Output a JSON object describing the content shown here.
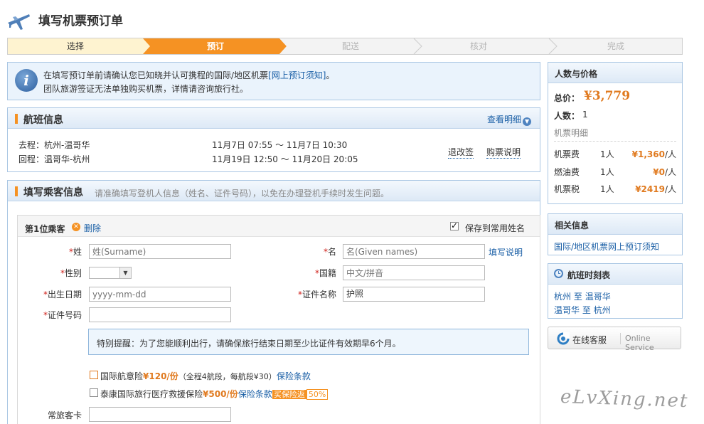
{
  "page": {
    "title": "填写机票预订单"
  },
  "steps": [
    {
      "label": "选择",
      "state": "done"
    },
    {
      "label": "预订",
      "state": "current"
    },
    {
      "label": "配送",
      "state": "todo"
    },
    {
      "label": "核对",
      "state": "todo"
    },
    {
      "label": "完成",
      "state": "todo"
    }
  ],
  "notice": {
    "line1": "在填写预订单前请确认您已知晓并认可携程的国际/地区机票",
    "link": "[网上预订须知]",
    "line1_end": "。",
    "line2": "团队旅游签证无法单独购买机票，详情请咨询旅行社。"
  },
  "flight": {
    "title": "航班信息",
    "detail_link": "查看明细",
    "outbound": {
      "label": "去程：",
      "route": "杭州-温哥华",
      "time": "11月7日 07:55 ～ 11月7日 10:30"
    },
    "return": {
      "label": "回程：",
      "route": "温哥华-杭州",
      "time": "11月19日 12:50 ～ 11月20日 20:05"
    },
    "refund_link": "退改签",
    "purchase_link": "购票说明"
  },
  "passenger": {
    "title": "填写乘客信息",
    "subtitle": "请准确填写登机人信息（姓名、证件号码），以免在办理登机手续时发生问题。",
    "first_label": "第1位乘客",
    "delete_label": "删除",
    "save_label": "保存到常用姓名",
    "surname_label": "姓",
    "surname_placeholder": "姓(Surname)",
    "given_label": "名",
    "given_placeholder": "名(Given names)",
    "help_link": "填写说明",
    "gender_label": "性别",
    "nationality_label": "国籍",
    "nationality_placeholder": "中文/拼音",
    "dob_label": "出生日期",
    "dob_placeholder": "yyyy-mm-dd",
    "id_type_label": "证件名称",
    "id_type_value": "护照",
    "id_no_label": "证件号码",
    "tip": "特别提醒：为了您能顺利出行，请确保旅行结束日期至少比证件有效期早6个月。",
    "ins1": {
      "name": "国际航意险",
      "price": "¥120/份",
      "desc": "（全程4航段，每航段¥30）",
      "link": "保险条款"
    },
    "ins2": {
      "name": "泰康国际旅行医疗救援保险",
      "price": "¥500/份",
      "link": "保险条款",
      "badge": "买保险返",
      "pct": "50%"
    },
    "ff_label": "常旅客卡"
  },
  "summary": {
    "title": "人数与价格",
    "total_label": "总价：",
    "total_value": "¥3,779",
    "count_label": "人数：",
    "count_value": "1",
    "detail_label": "机票明细",
    "fees": [
      {
        "name": "机票费",
        "qty": "1人",
        "price": "¥1,360",
        "unit": "/人"
      },
      {
        "name": "燃油费",
        "qty": "1人",
        "price": "¥0",
        "unit": "/人"
      },
      {
        "name": "机票税",
        "qty": "1人",
        "price": "¥2419",
        "unit": "/人"
      }
    ]
  },
  "related": {
    "title": "相关信息",
    "link": "国际/地区机票网上预订须知"
  },
  "schedule": {
    "title": "航班时刻表",
    "r1": {
      "from": "杭州",
      "to_word": "至",
      "to": "温哥华"
    },
    "r2": {
      "from": "温哥华",
      "to_word": "至",
      "to": "杭州"
    }
  },
  "online": {
    "cn": "在线客服",
    "en": "Online Service"
  },
  "watermark": "eLvXing.net",
  "colors": {
    "accent": "#f59223",
    "link": "#1a5fa6",
    "border": "#a9c6e3"
  }
}
